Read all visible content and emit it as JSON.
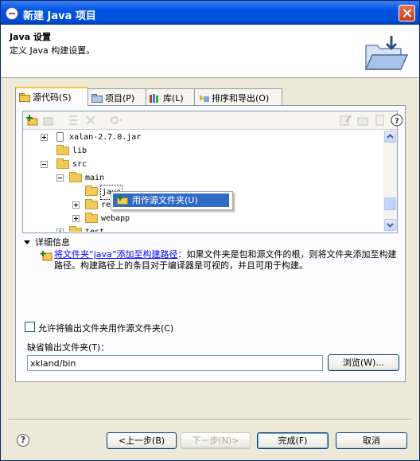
{
  "window": {
    "title": "新建 Java 项目"
  },
  "header": {
    "title": "Java 设置",
    "description": "定义 Java 构建设置。"
  },
  "tabs": [
    {
      "label": "源代码(S)",
      "active": true
    },
    {
      "label": "项目(P)",
      "active": false
    },
    {
      "label": "库(L)",
      "active": false
    },
    {
      "label": "排序和导出(O)",
      "active": false
    }
  ],
  "tree": {
    "items": [
      {
        "label": "xalan-2.7.0.jar",
        "type": "jar",
        "expander": "plus"
      },
      {
        "label": "lib",
        "type": "folder",
        "expander": "none"
      },
      {
        "label": "src",
        "type": "folder",
        "expander": "minus"
      },
      {
        "label": "main",
        "type": "folder",
        "expander": "minus"
      },
      {
        "label": "java",
        "type": "folder",
        "expander": "none",
        "selected": true
      },
      {
        "label": "resources",
        "type": "folder",
        "expander": "plus"
      },
      {
        "label": "webapp",
        "type": "folder",
        "expander": "plus"
      },
      {
        "label": "test",
        "type": "folder",
        "expander": "plus"
      }
    ]
  },
  "context_menu": {
    "item": "用作源文件夹(U)"
  },
  "details": {
    "toggle_label": "详细信息",
    "link_text": "将文件夹“java”添加至构建路径",
    "text": "：如果文件夹是包和源文件的根，则将文件夹添加至构建路径。构建路径上的条目对于编译器是可视的，并且可用于构建。"
  },
  "options": {
    "allow_output_label": "允许将输出文件夹用作源文件夹(C)",
    "allow_output_checked": false,
    "default_output_label": "缺省输出文件夹(T)：",
    "default_output_value": "xkland/bin",
    "browse_label": "浏览(W)..."
  },
  "buttons": {
    "back": "<上一步(B)",
    "next": "下一步(N)>",
    "finish": "完成(F)",
    "cancel": "取消"
  },
  "colors": {
    "title_bar": "#0054E3",
    "selection": "#316AC5",
    "dialog_bg": "#ECE9D8",
    "link": "#0000FF"
  }
}
